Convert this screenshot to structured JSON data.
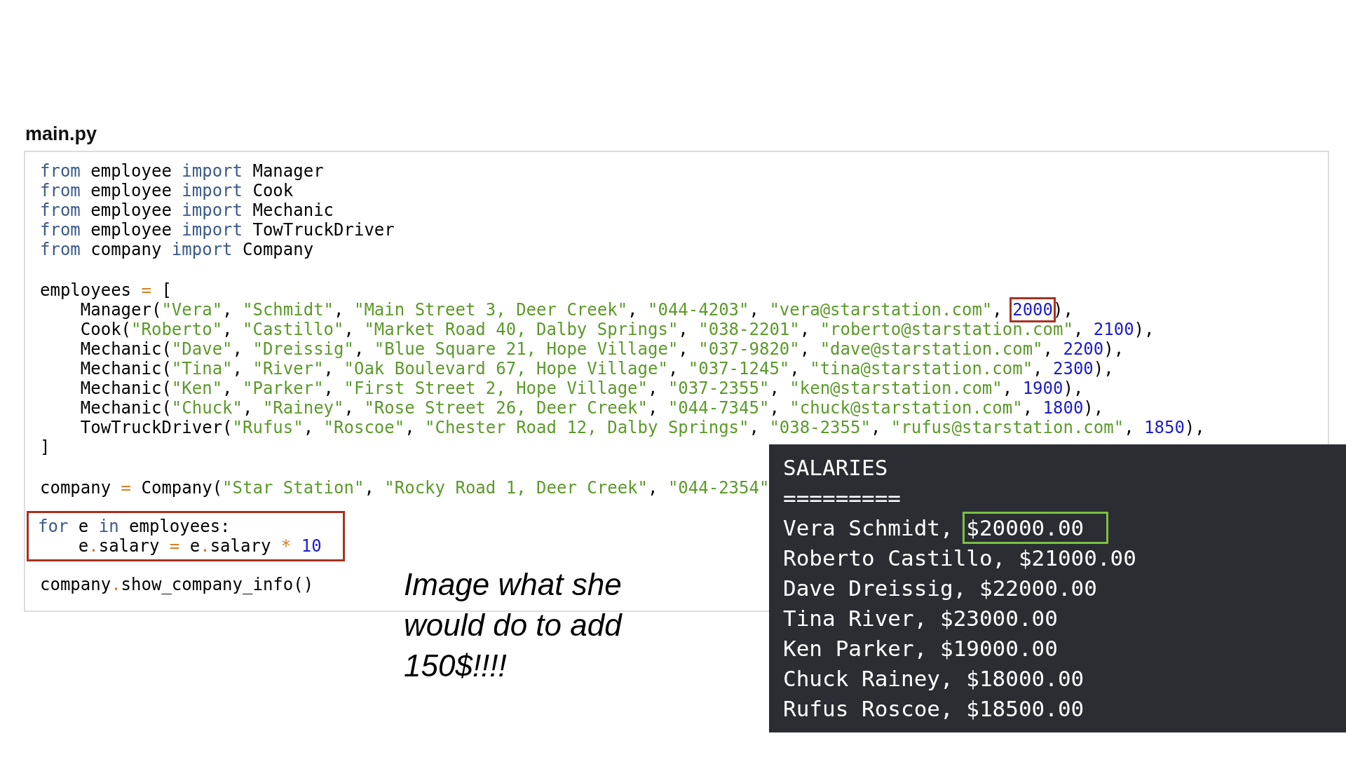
{
  "file_title": "main.py",
  "code_sections": [
    {
      "boxed": false,
      "lines": [
        [
          {
            "text": "from",
            "kind": "kw"
          },
          {
            "text": " employee ",
            "kind": "plain"
          },
          {
            "text": "import",
            "kind": "kw"
          },
          {
            "text": " Manager",
            "kind": "plain"
          }
        ],
        [
          {
            "text": "from",
            "kind": "kw"
          },
          {
            "text": " employee ",
            "kind": "plain"
          },
          {
            "text": "import",
            "kind": "kw"
          },
          {
            "text": " Cook",
            "kind": "plain"
          }
        ],
        [
          {
            "text": "from",
            "kind": "kw"
          },
          {
            "text": " employee ",
            "kind": "plain"
          },
          {
            "text": "import",
            "kind": "kw"
          },
          {
            "text": " Mechanic",
            "kind": "plain"
          }
        ],
        [
          {
            "text": "from",
            "kind": "kw"
          },
          {
            "text": " employee ",
            "kind": "plain"
          },
          {
            "text": "import",
            "kind": "kw"
          },
          {
            "text": " TowTruckDriver",
            "kind": "plain"
          }
        ],
        [
          {
            "text": "from",
            "kind": "kw"
          },
          {
            "text": " company ",
            "kind": "plain"
          },
          {
            "text": "import",
            "kind": "kw"
          },
          {
            "text": " Company",
            "kind": "plain"
          }
        ]
      ]
    },
    {
      "boxed": false,
      "lines": [
        [
          {
            "text": "employees ",
            "kind": "plain"
          },
          {
            "text": "=",
            "kind": "op"
          },
          {
            "text": " [",
            "kind": "plain"
          }
        ],
        [
          {
            "text": "    Manager(",
            "kind": "plain"
          },
          {
            "text": "\"Vera\"",
            "kind": "str"
          },
          {
            "text": ", ",
            "kind": "plain"
          },
          {
            "text": "\"Schmidt\"",
            "kind": "str"
          },
          {
            "text": ", ",
            "kind": "plain"
          },
          {
            "text": "\"Main Street 3, Deer Creek\"",
            "kind": "str"
          },
          {
            "text": ", ",
            "kind": "plain"
          },
          {
            "text": "\"044-4203\"",
            "kind": "str"
          },
          {
            "text": ", ",
            "kind": "plain"
          },
          {
            "text": "\"vera@starstation.com\"",
            "kind": "str"
          },
          {
            "text": ", ",
            "kind": "plain"
          },
          {
            "text": "2000",
            "kind": "num",
            "boxed": true
          },
          {
            "text": "),",
            "kind": "plain"
          }
        ],
        [
          {
            "text": "    Cook(",
            "kind": "plain"
          },
          {
            "text": "\"Roberto\"",
            "kind": "str"
          },
          {
            "text": ", ",
            "kind": "plain"
          },
          {
            "text": "\"Castillo\"",
            "kind": "str"
          },
          {
            "text": ", ",
            "kind": "plain"
          },
          {
            "text": "\"Market Road 40, Dalby Springs\"",
            "kind": "str"
          },
          {
            "text": ", ",
            "kind": "plain"
          },
          {
            "text": "\"038-2201\"",
            "kind": "str"
          },
          {
            "text": ", ",
            "kind": "plain"
          },
          {
            "text": "\"roberto@starstation.com\"",
            "kind": "str"
          },
          {
            "text": ", ",
            "kind": "plain"
          },
          {
            "text": "2100",
            "kind": "num"
          },
          {
            "text": "),",
            "kind": "plain"
          }
        ],
        [
          {
            "text": "    Mechanic(",
            "kind": "plain"
          },
          {
            "text": "\"Dave\"",
            "kind": "str"
          },
          {
            "text": ", ",
            "kind": "plain"
          },
          {
            "text": "\"Dreissig\"",
            "kind": "str"
          },
          {
            "text": ", ",
            "kind": "plain"
          },
          {
            "text": "\"Blue Square 21, Hope Village\"",
            "kind": "str"
          },
          {
            "text": ", ",
            "kind": "plain"
          },
          {
            "text": "\"037-9820\"",
            "kind": "str"
          },
          {
            "text": ", ",
            "kind": "plain"
          },
          {
            "text": "\"dave@starstation.com\"",
            "kind": "str"
          },
          {
            "text": ", ",
            "kind": "plain"
          },
          {
            "text": "2200",
            "kind": "num"
          },
          {
            "text": "),",
            "kind": "plain"
          }
        ],
        [
          {
            "text": "    Mechanic(",
            "kind": "plain"
          },
          {
            "text": "\"Tina\"",
            "kind": "str"
          },
          {
            "text": ", ",
            "kind": "plain"
          },
          {
            "text": "\"River\"",
            "kind": "str"
          },
          {
            "text": ", ",
            "kind": "plain"
          },
          {
            "text": "\"Oak Boulevard 67, Hope Village\"",
            "kind": "str"
          },
          {
            "text": ", ",
            "kind": "plain"
          },
          {
            "text": "\"037-1245\"",
            "kind": "str"
          },
          {
            "text": ", ",
            "kind": "plain"
          },
          {
            "text": "\"tina@starstation.com\"",
            "kind": "str"
          },
          {
            "text": ", ",
            "kind": "plain"
          },
          {
            "text": "2300",
            "kind": "num"
          },
          {
            "text": "),",
            "kind": "plain"
          }
        ],
        [
          {
            "text": "    Mechanic(",
            "kind": "plain"
          },
          {
            "text": "\"Ken\"",
            "kind": "str"
          },
          {
            "text": ", ",
            "kind": "plain"
          },
          {
            "text": "\"Parker\"",
            "kind": "str"
          },
          {
            "text": ", ",
            "kind": "plain"
          },
          {
            "text": "\"First Street 2, Hope Village\"",
            "kind": "str"
          },
          {
            "text": ", ",
            "kind": "plain"
          },
          {
            "text": "\"037-2355\"",
            "kind": "str"
          },
          {
            "text": ", ",
            "kind": "plain"
          },
          {
            "text": "\"ken@starstation.com\"",
            "kind": "str"
          },
          {
            "text": ", ",
            "kind": "plain"
          },
          {
            "text": "1900",
            "kind": "num"
          },
          {
            "text": "),",
            "kind": "plain"
          }
        ],
        [
          {
            "text": "    Mechanic(",
            "kind": "plain"
          },
          {
            "text": "\"Chuck\"",
            "kind": "str"
          },
          {
            "text": ", ",
            "kind": "plain"
          },
          {
            "text": "\"Rainey\"",
            "kind": "str"
          },
          {
            "text": ", ",
            "kind": "plain"
          },
          {
            "text": "\"Rose Street 26, Deer Creek\"",
            "kind": "str"
          },
          {
            "text": ", ",
            "kind": "plain"
          },
          {
            "text": "\"044-7345\"",
            "kind": "str"
          },
          {
            "text": ", ",
            "kind": "plain"
          },
          {
            "text": "\"chuck@starstation.com\"",
            "kind": "str"
          },
          {
            "text": ", ",
            "kind": "plain"
          },
          {
            "text": "1800",
            "kind": "num"
          },
          {
            "text": "),",
            "kind": "plain"
          }
        ],
        [
          {
            "text": "    TowTruckDriver(",
            "kind": "plain"
          },
          {
            "text": "\"Rufus\"",
            "kind": "str"
          },
          {
            "text": ", ",
            "kind": "plain"
          },
          {
            "text": "\"Roscoe\"",
            "kind": "str"
          },
          {
            "text": ", ",
            "kind": "plain"
          },
          {
            "text": "\"Chester Road 12, Dalby Springs\"",
            "kind": "str"
          },
          {
            "text": ", ",
            "kind": "plain"
          },
          {
            "text": "\"038-2355\"",
            "kind": "str"
          },
          {
            "text": ", ",
            "kind": "plain"
          },
          {
            "text": "\"rufus@starstation.com\"",
            "kind": "str"
          },
          {
            "text": ", ",
            "kind": "plain"
          },
          {
            "text": "1850",
            "kind": "num"
          },
          {
            "text": "),",
            "kind": "plain"
          }
        ],
        [
          {
            "text": "]",
            "kind": "plain"
          }
        ]
      ]
    },
    {
      "boxed": false,
      "lines": [
        [
          {
            "text": "company ",
            "kind": "plain"
          },
          {
            "text": "=",
            "kind": "op"
          },
          {
            "text": " Company(",
            "kind": "plain"
          },
          {
            "text": "\"Star Station\"",
            "kind": "str"
          },
          {
            "text": ", ",
            "kind": "plain"
          },
          {
            "text": "\"Rocky Road 1, Deer Creek\"",
            "kind": "str"
          },
          {
            "text": ", ",
            "kind": "plain"
          },
          {
            "text": "\"044-2354\"",
            "kind": "str"
          }
        ]
      ]
    },
    {
      "boxed": true,
      "lines": [
        [
          {
            "text": "for",
            "kind": "kw"
          },
          {
            "text": " e ",
            "kind": "plain"
          },
          {
            "text": "in",
            "kind": "kw"
          },
          {
            "text": " employees:",
            "kind": "plain"
          }
        ],
        [
          {
            "text": "    e",
            "kind": "plain"
          },
          {
            "text": ".",
            "kind": "op"
          },
          {
            "text": "salary ",
            "kind": "plain"
          },
          {
            "text": "=",
            "kind": "op"
          },
          {
            "text": " e",
            "kind": "plain"
          },
          {
            "text": ".",
            "kind": "op"
          },
          {
            "text": "salary ",
            "kind": "plain"
          },
          {
            "text": "* ",
            "kind": "op"
          },
          {
            "text": "10",
            "kind": "num"
          }
        ]
      ]
    },
    {
      "boxed": false,
      "lines": [
        [
          {
            "text": "company",
            "kind": "plain"
          },
          {
            "text": ".",
            "kind": "op"
          },
          {
            "text": "show_company_info()",
            "kind": "plain"
          }
        ]
      ]
    }
  ],
  "caption": "Image what she would do to add 150$!!!!",
  "output": {
    "title": "SALARIES",
    "rule": "=========",
    "rows": [
      {
        "name": "Vera Schmidt,",
        "amount": "$20000.00",
        "boxed": true
      },
      {
        "name": "Roberto Castillo,",
        "amount": "$21000.00",
        "boxed": false
      },
      {
        "name": "Dave Dreissig,",
        "amount": "$22000.00",
        "boxed": false
      },
      {
        "name": "Tina River,",
        "amount": "$23000.00",
        "boxed": false
      },
      {
        "name": "Ken Parker,",
        "amount": "$19000.00",
        "boxed": false
      },
      {
        "name": "Chuck Rainey,",
        "amount": "$18000.00",
        "boxed": false
      },
      {
        "name": "Rufus Roscoe,",
        "amount": "$18500.00",
        "boxed": false
      }
    ]
  }
}
